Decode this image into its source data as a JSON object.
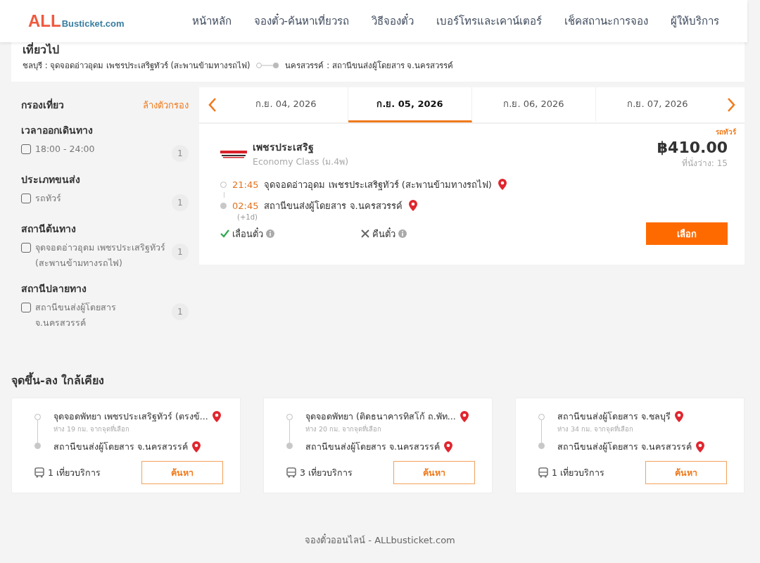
{
  "header": {
    "logo": {
      "main": "ALL",
      "rest": "Busticket.com"
    },
    "nav": [
      {
        "label": "หน้าหลัก"
      },
      {
        "label": "จองตั๋ว-ค้นหาเที่ยวรถ"
      },
      {
        "label": "วิธีจองตั๋ว"
      },
      {
        "label": "เบอร์โทรและเคาน์เตอร์"
      },
      {
        "label": "เช็คสถานะการจอง"
      },
      {
        "label": "ผู้ให้บริการ"
      }
    ]
  },
  "trip_summary": {
    "title": "เที่ยวไป",
    "origin": "ชลบุรี : จุดจอดอ่าวอุดม เพชรประเสริฐทัวร์ (สะพานข้ามทางรถไฟ)",
    "destination": "นครสวรรค์ : สถานีขนส่งผู้โดยสาร จ.นครสวรรค์"
  },
  "filters": {
    "title": "กรองเที่ยว",
    "clear_label": "ล้างตัวกรอง",
    "groups": [
      {
        "title": "เวลาออกเดินทาง",
        "options": [
          {
            "label": "18:00 - 24:00",
            "count": "1",
            "checked": false
          }
        ]
      },
      {
        "title": "ประเภทขนส่ง",
        "options": [
          {
            "label": "รถทัวร์",
            "count": "1",
            "checked": false
          }
        ]
      },
      {
        "title": "สถานีต้นทาง",
        "options": [
          {
            "label": "จุดจอดอ่าวอุดม เพชรประเสริฐทัวร์ (สะพานข้ามทางรถไฟ)",
            "count": "1",
            "checked": false
          }
        ]
      },
      {
        "title": "สถานีปลายทาง",
        "options": [
          {
            "label": "สถานีขนส่งผู้โดยสาร จ.นครสวรรค์",
            "count": "1",
            "checked": false
          }
        ]
      }
    ]
  },
  "dates": [
    {
      "label": "ก.ย. 04, 2026",
      "selected": false
    },
    {
      "label": "ก.ย. 05, 2026",
      "selected": true
    },
    {
      "label": "ก.ย. 06, 2026",
      "selected": false
    },
    {
      "label": "ก.ย. 07, 2026",
      "selected": false
    }
  ],
  "trips": [
    {
      "vehicle_type": "รถทัวร์",
      "operator": "เพชรประเสริฐ",
      "class": "Economy Class (ม.4พ)",
      "price": "฿410.00",
      "seats": "ที่นั่งว่าง: 15",
      "depart_time": "21:45",
      "depart_place": "จุดจอดอ่าวอุดม เพชรประเสริฐทัวร์ (สะพานข้ามทางรถไฟ)",
      "arrive_time": "02:45",
      "arrive_place": "สถานีขนส่งผู้โดยสาร จ.นครสวรรค์",
      "arrive_note": "(+1d)",
      "policies": [
        {
          "label": "เลื่อนตั๋ว",
          "allowed": true
        },
        {
          "label": "คืนตั๋ว",
          "allowed": false
        }
      ],
      "select_label": "เลือก"
    }
  ],
  "nearby": {
    "title": "จุดขึ้น-ลง ใกล้เคียง",
    "cards": [
      {
        "from": "จุดจอดพัทยา เพชรประเสริฐทัวร์ (ตรงข้...",
        "distance": "ห่าง 19 กม. จากจุดที่เลือก",
        "to": "สถานีขนส่งผู้โดยสาร จ.นครสวรรค์",
        "trips": "1 เที่ยวบริการ",
        "button": "ค้นหา"
      },
      {
        "from": "จุดจอดพัทยา (ติดธนาคารทิสโก้ ถ.พัท...",
        "distance": "ห่าง 20 กม. จากจุดที่เลือก",
        "to": "สถานีขนส่งผู้โดยสาร จ.นครสวรรค์",
        "trips": "3 เที่ยวบริการ",
        "button": "ค้นหา"
      },
      {
        "from": "สถานีขนส่งผู้โดยสาร จ.ชลบุรี",
        "distance": "ห่าง 34 กม. จากจุดที่เลือก",
        "to": "สถานีขนส่งผู้โดยสาร จ.นครสวรรค์",
        "trips": "1 เที่ยวบริการ",
        "button": "ค้นหา"
      }
    ]
  },
  "footer": "จองตั๋วออนไลน์ - ALLbusticket.com"
}
